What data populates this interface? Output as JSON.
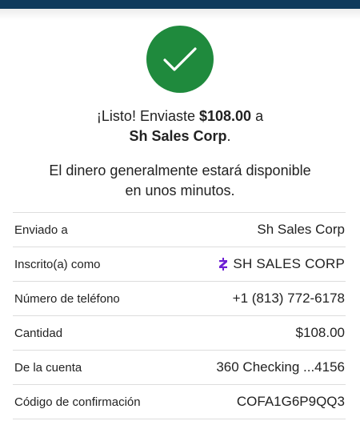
{
  "confirmation": {
    "prefix": "¡Listo! Enviaste ",
    "amount": "$108.00",
    "suffix": " a",
    "recipient": "Sh Sales Corp",
    "recipient_suffix": ".",
    "availability_line1": "El dinero generalmente estará disponible",
    "availability_line2": "en unos minutos."
  },
  "details": [
    {
      "label": "Enviado a",
      "value": "Sh Sales Corp"
    },
    {
      "label": "Inscrito(a) como",
      "value": "SH SALES CORP",
      "icon": "zelle-icon"
    },
    {
      "label": "Número de teléfono",
      "value": "+1 (813) 772-6178"
    },
    {
      "label": "Cantidad",
      "value": "$108.00"
    },
    {
      "label": "De la cuenta",
      "value": "360 Checking ...4156"
    },
    {
      "label": "Código de confirmación",
      "value": "COFA1G6P9QQ3"
    }
  ],
  "icons": {
    "success": "checkmark-icon",
    "enrolled": "zelle-icon"
  },
  "colors": {
    "success_green": "#1f8a3d",
    "header_navy": "#0e3a5c",
    "zelle_purple": "#6d1ed4"
  }
}
